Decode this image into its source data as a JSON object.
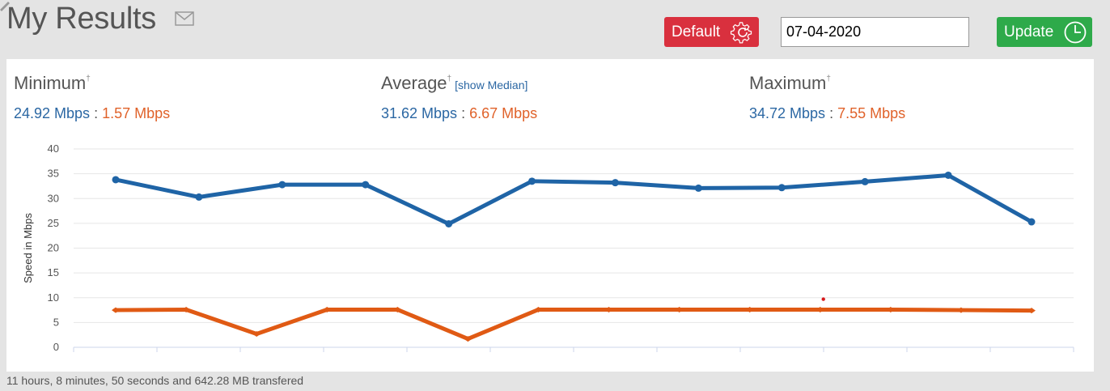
{
  "header": {
    "title": "My Results",
    "default_label": "Default",
    "date_value": "07-04-2020",
    "update_label": "Update"
  },
  "stats": {
    "minimum": {
      "label": "Minimum",
      "mark": "†",
      "download": "24.92 Mbps",
      "upload": "1.57 Mbps"
    },
    "average": {
      "label": "Average",
      "mark": "†",
      "link": "[show Median]",
      "download": "31.62 Mbps",
      "upload": "6.67 Mbps"
    },
    "maximum": {
      "label": "Maximum",
      "mark": "†",
      "download": "34.72 Mbps",
      "upload": "7.55 Mbps"
    },
    "separator": " : "
  },
  "chart_data": {
    "type": "line",
    "ylabel": "Speed in Mbps",
    "ylim": [
      0,
      40
    ],
    "yticks": [
      0,
      5,
      10,
      15,
      20,
      25,
      30,
      35,
      40
    ],
    "grid": true,
    "series": [
      {
        "color": "#1f64a6",
        "values": [
          33.8,
          30.3,
          32.8,
          32.8,
          24.9,
          33.5,
          33.2,
          32.1,
          32.2,
          33.4,
          34.7,
          25.3
        ]
      },
      {
        "color": "#e05a14",
        "values": [
          7.5,
          7.6,
          2.7,
          7.6,
          7.6,
          1.7,
          7.6,
          7.6,
          7.6,
          7.6,
          7.6,
          7.6,
          7.5,
          7.4
        ]
      }
    ],
    "annotation_point": {
      "x_index": 8.5,
      "y": 9.7,
      "color": "#d7191c"
    }
  },
  "footer": {
    "text": "11 hours, 8 minutes, 50 seconds and 642.28 MB transfered"
  },
  "colors": {
    "default_button": "#d9303e",
    "update_button": "#2eaa4a",
    "download": "#2b67a3",
    "upload": "#e0622a"
  }
}
